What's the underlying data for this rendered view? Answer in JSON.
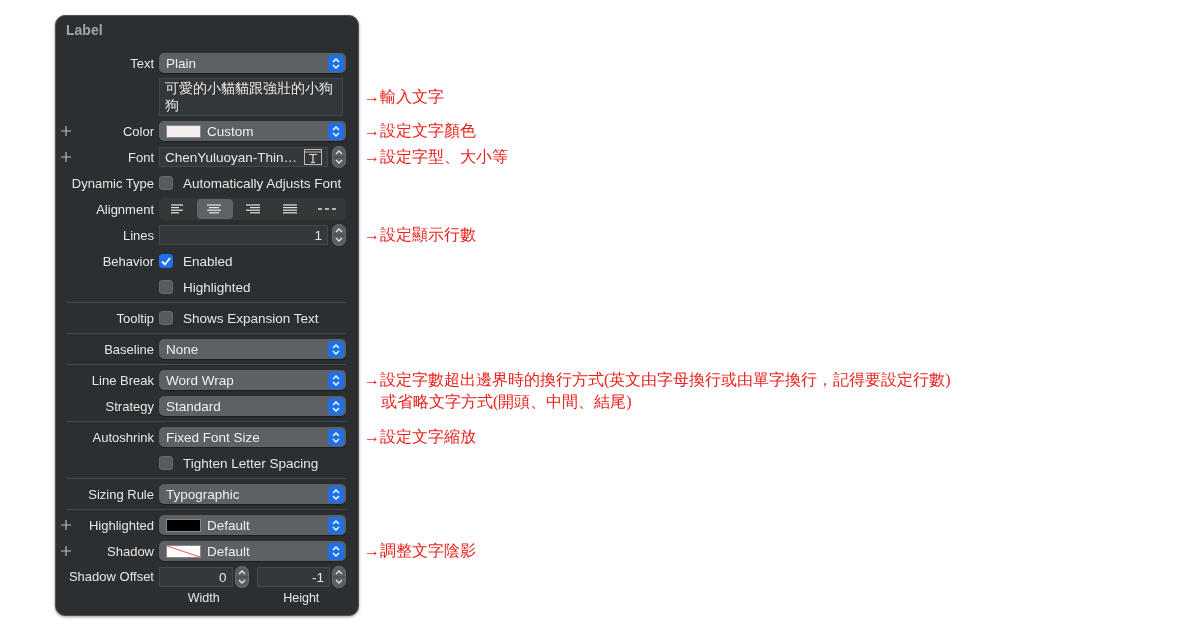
{
  "panel": {
    "title": "Label",
    "rows": [
      {
        "kind": "popup",
        "label": "Text",
        "value": "Plain"
      },
      {
        "kind": "textarea",
        "value": "可愛的小貓貓跟強壯的小狗狗",
        "notes": [
          "→輸入文字"
        ]
      },
      {
        "kind": "popup",
        "label": "Color",
        "value": "Custom",
        "plus": true,
        "swatch": {
          "kind": "solid",
          "color": "#f4eeef"
        },
        "notes": [
          "→設定文字顏色"
        ]
      },
      {
        "kind": "font",
        "label": "Font",
        "value": "ChenYuluoyan-Thin…",
        "plus": true,
        "notes": [
          "→設定字型、大小等"
        ]
      },
      {
        "kind": "checkbox",
        "label": "Dynamic Type",
        "text": "Automatically Adjusts Font",
        "checked": false
      },
      {
        "kind": "segmented",
        "label": "Alignment",
        "segments": [
          {
            "kind": "left",
            "selected": false
          },
          {
            "kind": "center",
            "selected": true
          },
          {
            "kind": "right",
            "selected": false
          },
          {
            "kind": "justify",
            "selected": false
          },
          {
            "kind": "natural",
            "selected": false
          }
        ]
      },
      {
        "kind": "stepper",
        "label": "Lines",
        "value": "1",
        "notes": [
          "→設定顯示行數"
        ]
      },
      {
        "kind": "checkbox",
        "label": "Behavior",
        "text": "Enabled",
        "checked": true
      },
      {
        "kind": "checkbox",
        "text": "Highlighted",
        "checked": false
      },
      {
        "kind": "divider"
      },
      {
        "kind": "checkbox",
        "label": "Tooltip",
        "text": "Shows Expansion Text",
        "checked": false
      },
      {
        "kind": "divider"
      },
      {
        "kind": "popup",
        "label": "Baseline",
        "value": "None"
      },
      {
        "kind": "divider"
      },
      {
        "kind": "popup",
        "label": "Line Break",
        "value": "Word Wrap",
        "notes": [
          "→設定字數超出邊界時的換行方式(英文由字母換行或由單字換行，記得要設定行數)",
          "或省略文字方式(開頭、中間、結尾)"
        ]
      },
      {
        "kind": "popup",
        "label": "Strategy",
        "value": "Standard"
      },
      {
        "kind": "divider"
      },
      {
        "kind": "popup",
        "label": "Autoshrink",
        "value": "Fixed Font Size",
        "notes": [
          "→設定文字縮放"
        ]
      },
      {
        "kind": "checkbox",
        "text": "Tighten Letter Spacing",
        "checked": false
      },
      {
        "kind": "divider"
      },
      {
        "kind": "popup",
        "label": "Sizing Rule",
        "value": "Typographic"
      },
      {
        "kind": "divider"
      },
      {
        "kind": "popup",
        "label": "Highlighted",
        "value": "Default",
        "plus": true,
        "swatch": {
          "kind": "solid",
          "color": "#000000"
        }
      },
      {
        "kind": "popup",
        "label": "Shadow",
        "value": "Default",
        "plus": true,
        "swatch": {
          "kind": "empty"
        },
        "notes": [
          "→調整文字陰影"
        ]
      },
      {
        "kind": "offset",
        "label": "Shadow Offset",
        "fields": [
          {
            "value": "0",
            "caption": "Width"
          },
          {
            "value": "-1",
            "caption": "Height"
          }
        ]
      }
    ]
  }
}
